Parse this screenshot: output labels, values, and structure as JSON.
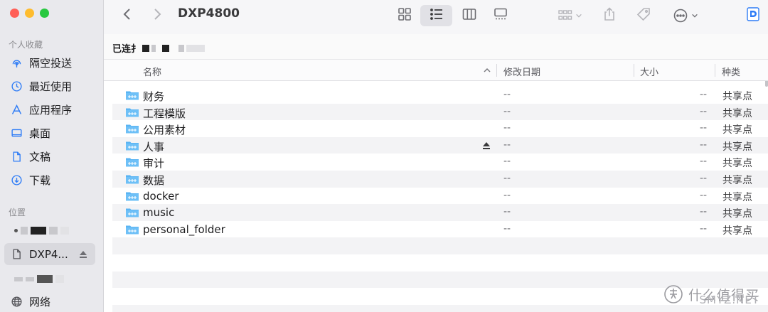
{
  "window": {
    "title": "DXP4800"
  },
  "sidebar": {
    "favorites_label": "个人收藏",
    "favorites": [
      {
        "label": "隔空投送",
        "icon": "airdrop-icon"
      },
      {
        "label": "最近使用",
        "icon": "clock-icon"
      },
      {
        "label": "应用程序",
        "icon": "applications-icon"
      },
      {
        "label": "桌面",
        "icon": "desktop-icon"
      },
      {
        "label": "文稿",
        "icon": "document-icon"
      },
      {
        "label": "下载",
        "icon": "download-icon"
      }
    ],
    "locations_label": "位置",
    "locations": [
      {
        "label": "DXP4...",
        "icon": "document-icon",
        "active": true
      },
      {
        "label": "网络",
        "icon": "globe-icon"
      }
    ]
  },
  "pathbar": {
    "text": "已连扌"
  },
  "columns": {
    "name": "名称",
    "date": "修改日期",
    "size": "大小",
    "kind": "种类"
  },
  "files": [
    {
      "name": "财务",
      "date": "--",
      "size": "--",
      "kind": "共享点"
    },
    {
      "name": "工程模版",
      "date": "--",
      "size": "--",
      "kind": "共享点"
    },
    {
      "name": "公用素材",
      "date": "--",
      "size": "--",
      "kind": "共享点"
    },
    {
      "name": "人事",
      "date": "--",
      "size": "--",
      "kind": "共享点",
      "ejectable": true
    },
    {
      "name": "审计",
      "date": "--",
      "size": "--",
      "kind": "共享点"
    },
    {
      "name": "数据",
      "date": "--",
      "size": "--",
      "kind": "共享点"
    },
    {
      "name": "docker",
      "date": "--",
      "size": "--",
      "kind": "共享点"
    },
    {
      "name": "music",
      "date": "--",
      "size": "--",
      "kind": "共享点"
    },
    {
      "name": "personal_folder",
      "date": "--",
      "size": "--",
      "kind": "共享点"
    }
  ],
  "watermark": {
    "text": "什么值得买",
    "site": "SMYZ.NET"
  },
  "colors": {
    "accent": "#2e7cf6",
    "folder": "#5ab4f3",
    "sidebar_bg": "#e9e9ed"
  }
}
